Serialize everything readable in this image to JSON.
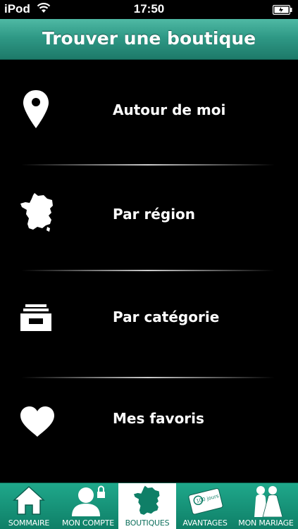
{
  "status_bar": {
    "carrier": "iPod",
    "time": "17:50"
  },
  "header": {
    "title": "Trouver une boutique"
  },
  "menu": [
    {
      "label": "Autour de moi",
      "icon": "location-pin-icon"
    },
    {
      "label": "Par région",
      "icon": "france-map-icon"
    },
    {
      "label": "Par catégorie",
      "icon": "archive-tray-icon"
    },
    {
      "label": "Mes favoris",
      "icon": "heart-icon"
    }
  ],
  "tabs": [
    {
      "label": "SOMMAIRE",
      "icon": "home-icon"
    },
    {
      "label": "MON COMPTE",
      "icon": "user-lock-icon"
    },
    {
      "label": "BOUTIQUES",
      "icon": "france-map-icon",
      "active": true
    },
    {
      "label": "AVANTAGES",
      "icon": "card-icon",
      "card_text": "100 jours"
    },
    {
      "label": "MON MARIAGE",
      "icon": "couple-icon"
    }
  ],
  "colors": {
    "header": "#2f9986",
    "tab_bar": "#1fa88b",
    "active_tab_text": "#0d6f5c"
  }
}
